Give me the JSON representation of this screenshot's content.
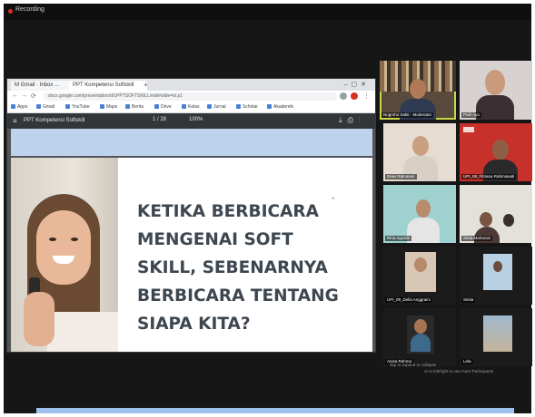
{
  "window": {
    "recording_label": "Recording"
  },
  "browser": {
    "tabs": [
      {
        "label": "M Gmail · Inbox ..."
      },
      {
        "label": "PPT Kompetensi Softskill"
      }
    ],
    "address": "docs.google.com/presentation/d/1PPTSOFTSKILL/edit#slide=id.p1",
    "bookmarks": [
      "Apps",
      "Gmail",
      "YouTube",
      "Maps",
      "Berita",
      "Drive",
      "Kelas",
      "Jurnal",
      "Scholar",
      "Akademik"
    ],
    "pdf": {
      "file_name": "PPT Kompetensi Softskill",
      "page_indicator": "1 / 28",
      "zoom": "100%"
    }
  },
  "slide": {
    "lines": [
      "KETIKA BERBICARA",
      "MENGENAI SOFT",
      "SKILL, SEBENARNYA",
      "BERBICARA TENTANG",
      "SIAPA KITA?"
    ]
  },
  "gallery": {
    "participants": [
      {
        "name": "Nugroho Sakti · Moderator",
        "active": true
      },
      {
        "name": "Putri Ayu",
        "active": false
      },
      {
        "name": "Dewi Ratnasari",
        "active": false
      },
      {
        "name": "UPI_08_Fitriana Rahmawati",
        "active": false
      },
      {
        "name": "Rina Agustin",
        "active": false
      },
      {
        "name": "Sinta Maharani",
        "active": false
      },
      {
        "name": "UPI_09_Della Anggraini",
        "active": false
      },
      {
        "name": "Sintia",
        "active": false
      },
      {
        "name": "Anisa Rahma",
        "active": false
      },
      {
        "name": "Lela",
        "active": false
      }
    ],
    "hint_line_1": "Tap to expand or collapse",
    "hint_line_2": "or to left/right to see more Participants"
  }
}
